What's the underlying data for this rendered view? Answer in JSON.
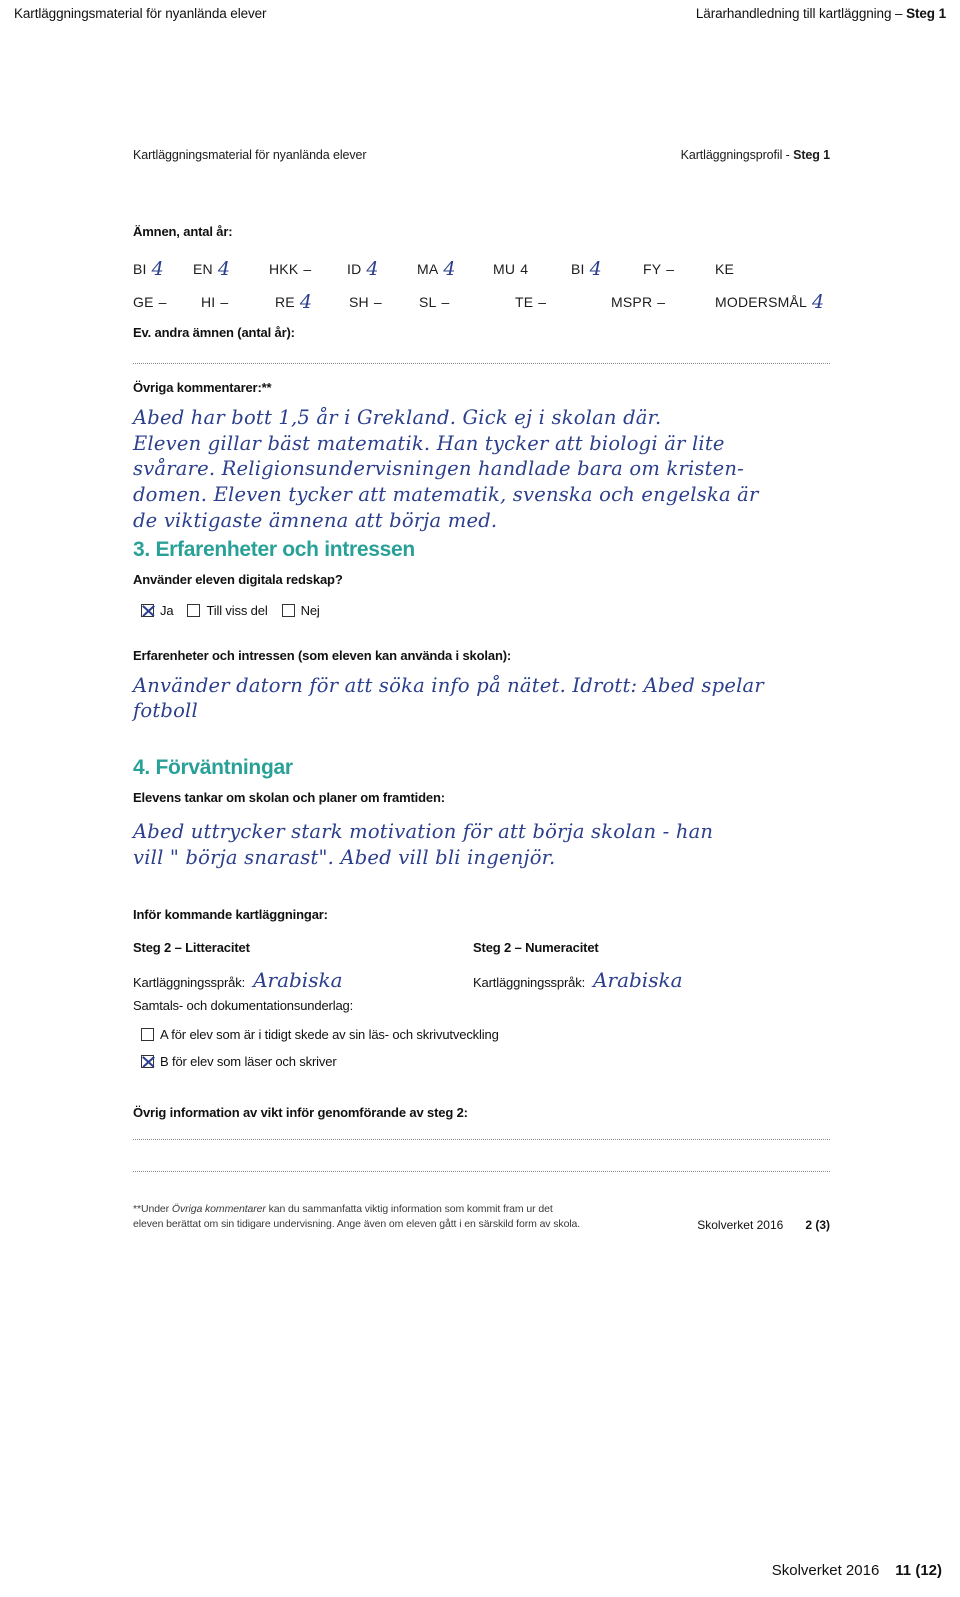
{
  "page_header": {
    "left": "Kartläggningsmaterial för nyanlända elever",
    "right_plain": "Lärarhandledning till kartläggning – ",
    "right_bold": "Steg 1"
  },
  "doc_head": {
    "left": "Kartläggningsmaterial för nyanlända elever",
    "right_plain": "Kartläggningsprofil - ",
    "right_bold": "Steg 1"
  },
  "subjects": {
    "label": "Ämnen, antal år:",
    "row1": [
      {
        "code": "BI",
        "value": "4",
        "style": "hand"
      },
      {
        "code": "EN",
        "value": "4",
        "style": "hand"
      },
      {
        "code": "HKK",
        "value": "–",
        "style": "dash"
      },
      {
        "code": "ID",
        "value": "4",
        "style": "hand"
      },
      {
        "code": "MA",
        "value": "4",
        "style": "hand"
      },
      {
        "code": "MU",
        "value": "4",
        "style": "printed"
      },
      {
        "code": "BI",
        "value": "4",
        "style": "hand"
      },
      {
        "code": "FY",
        "value": "–",
        "style": "dash"
      },
      {
        "code": "KE",
        "value": "",
        "style": "none"
      }
    ],
    "row2": [
      {
        "code": "GE",
        "value": "–",
        "style": "dash"
      },
      {
        "code": "HI",
        "value": "–",
        "style": "dash"
      },
      {
        "code": "RE",
        "value": "4",
        "style": "hand"
      },
      {
        "code": "SH",
        "value": "–",
        "style": "dash"
      },
      {
        "code": "SL",
        "value": "–",
        "style": "dash"
      },
      {
        "code": "TE",
        "value": "–",
        "style": "dash"
      },
      {
        "code": "MSPR",
        "value": "–",
        "style": "dash"
      },
      {
        "code": "MODERSMÅL",
        "value": "4",
        "style": "hand"
      }
    ]
  },
  "other_subjects": {
    "label": "Ev. andra ämnen (antal år):"
  },
  "comments": {
    "label": "Övriga kommentarer:**",
    "line1": "Abed har bott 1,5 år i Grekland. Gick ej i skolan där.",
    "line2": "Eleven gillar bäst matematik. Han tycker att biologi är lite",
    "line3": "svårare. Religionsundervisningen handlade bara om kristen-",
    "line4": "domen. Eleven tycker att matematik, svenska och engelska är",
    "line5": "de viktigaste ämnena att börja med."
  },
  "section3": {
    "heading": "3. Erfarenheter och intressen",
    "question": "Använder eleven digitala redskap?",
    "options": [
      {
        "label": "Ja",
        "checked": true
      },
      {
        "label": "Till viss del",
        "checked": false
      },
      {
        "label": "Nej",
        "checked": false
      }
    ],
    "experience_label": "Erfarenheter och intressen (som eleven kan använda i skolan):",
    "experience_line1": "Använder datorn för att söka info på nätet. Idrott: Abed spelar",
    "experience_line2": "fotboll"
  },
  "section4": {
    "heading": "4. Förväntningar",
    "thoughts_label": "Elevens tankar om skolan och planer om framtiden:",
    "thoughts_line1": "Abed uttrycker stark motivation för att börja skolan - han",
    "thoughts_line2": "vill \" börja snarast\". Abed vill bli ingenjör."
  },
  "upcoming": {
    "label": "Inför kommande kartläggningar:",
    "col_left": {
      "title": "Steg 2 – Litteracitet",
      "language_label": "Kartläggningsspråk:",
      "language_value": "Arabiska"
    },
    "col_right": {
      "title": "Steg 2 – Numeracitet",
      "language_label": "Kartläggningsspråk:",
      "language_value": "Arabiska"
    },
    "documents_label": "Samtals- och dokumentationsunderlag:",
    "documents": [
      {
        "label": "A för elev som är i tidigt skede av sin läs- och skrivutveckling",
        "checked": false
      },
      {
        "label": "B för elev som läser och skriver",
        "checked": true
      }
    ]
  },
  "extra_info": {
    "label": "Övrig information av vikt inför genomförande av steg 2:"
  },
  "footnote": {
    "prefix": "**Under ",
    "italic": "Övriga kommentarer",
    "rest_line1": " kan du sammanfatta viktig information som kommit fram ur det",
    "line2": "eleven berättat om sin tidigare undervisning. Ange även om eleven gått i en särskild form av skola."
  },
  "form_footer": {
    "source": "Skolverket 2016",
    "page": "2 (3)"
  },
  "page_footer": {
    "source": "Skolverket 2016",
    "page": "11 (12)"
  },
  "colors": {
    "heading_teal": "#2aa198",
    "handwriting_blue": "#2b3f8c"
  }
}
